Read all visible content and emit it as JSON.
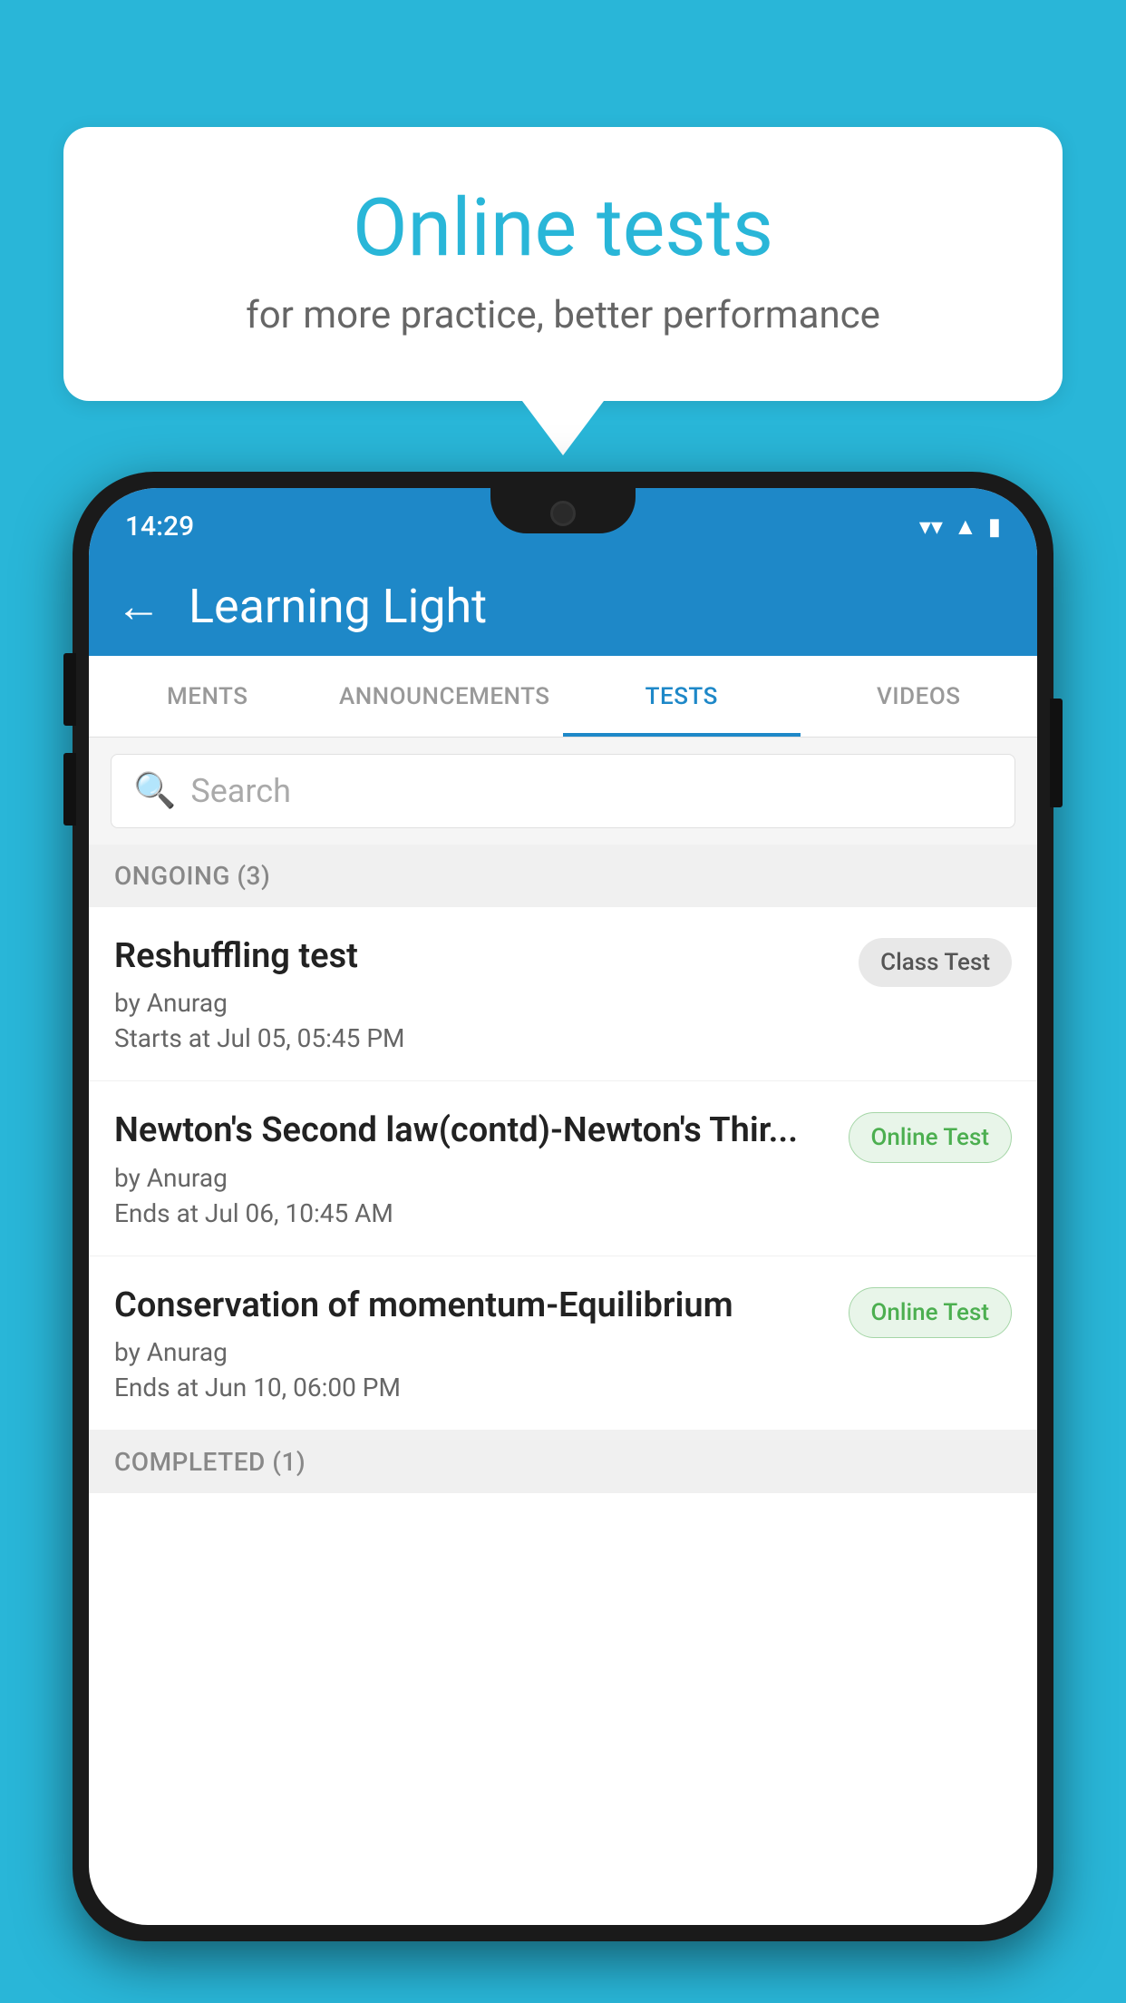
{
  "background_color": "#29b6d8",
  "speech_bubble": {
    "title": "Online tests",
    "subtitle": "for more practice, better performance"
  },
  "phone": {
    "status_bar": {
      "time": "14:29",
      "wifi_icon": "▼",
      "signal_icon": "▲",
      "battery_icon": "▮"
    },
    "header": {
      "back_label": "←",
      "title": "Learning Light"
    },
    "tabs": [
      {
        "label": "MENTS",
        "active": false
      },
      {
        "label": "ANNOUNCEMENTS",
        "active": false
      },
      {
        "label": "TESTS",
        "active": true
      },
      {
        "label": "VIDEOS",
        "active": false
      }
    ],
    "search": {
      "placeholder": "Search",
      "icon": "🔍"
    },
    "ongoing_section": {
      "label": "ONGOING (3)"
    },
    "tests": [
      {
        "title": "Reshuffling test",
        "by": "by Anurag",
        "date": "Starts at  Jul 05, 05:45 PM",
        "badge": "Class Test",
        "badge_type": "class"
      },
      {
        "title": "Newton's Second law(contd)-Newton's Thir...",
        "by": "by Anurag",
        "date": "Ends at  Jul 06, 10:45 AM",
        "badge": "Online Test",
        "badge_type": "online"
      },
      {
        "title": "Conservation of momentum-Equilibrium",
        "by": "by Anurag",
        "date": "Ends at  Jun 10, 06:00 PM",
        "badge": "Online Test",
        "badge_type": "online"
      }
    ],
    "completed_section": {
      "label": "COMPLETED (1)"
    }
  }
}
